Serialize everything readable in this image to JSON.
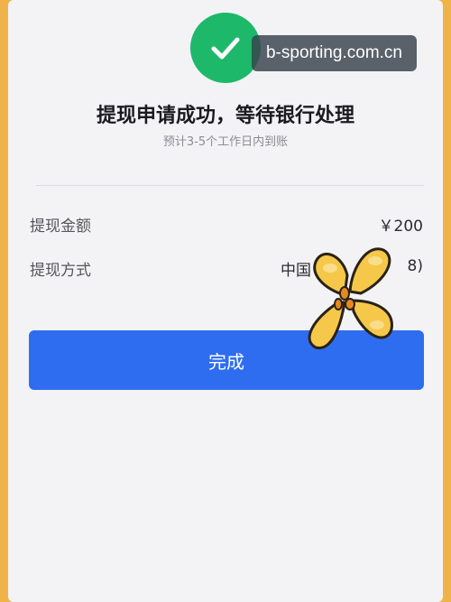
{
  "watermark": "b-sporting.com.cn",
  "result": {
    "title": "提现申请成功，等待银行处理",
    "subtitle": "预计3-5个工作日内到账"
  },
  "details": [
    {
      "label": "提现金额",
      "value": "￥200"
    },
    {
      "label": "提现方式",
      "value": "中国",
      "value_tail": "8)"
    }
  ],
  "done_button": "完成",
  "icons": {
    "status": "check-icon",
    "overlay": "flower-sticker"
  },
  "colors": {
    "success": "#1db86a",
    "primary": "#2f6df0",
    "frame": "#f0b34a"
  }
}
